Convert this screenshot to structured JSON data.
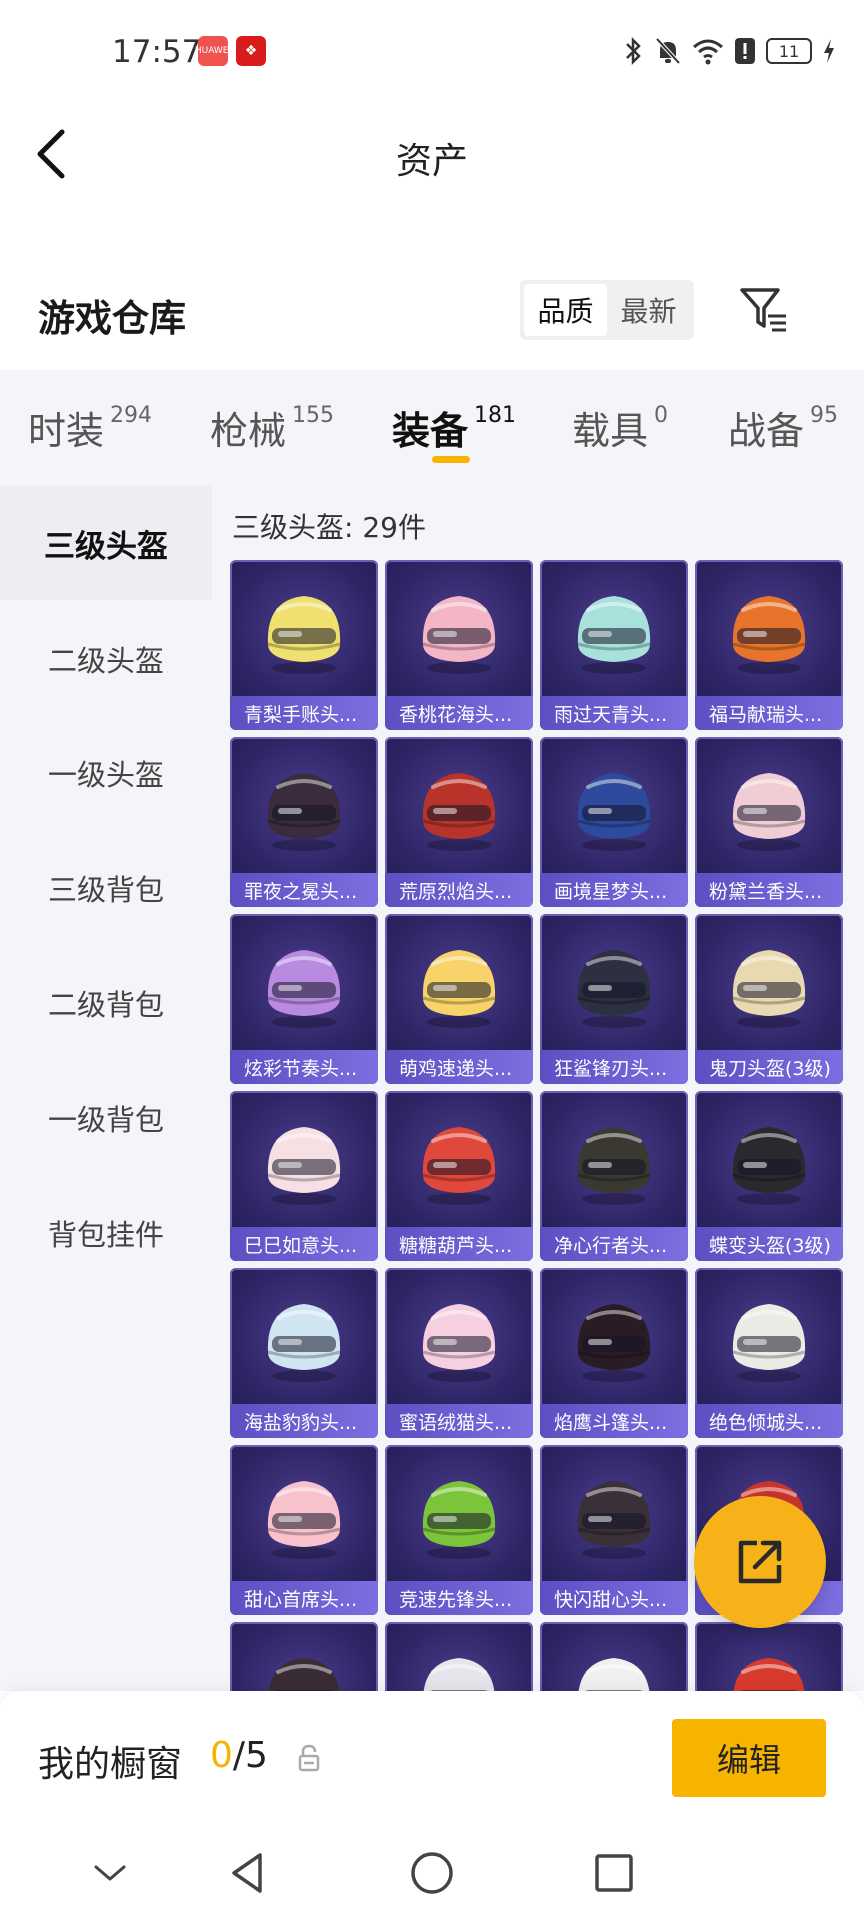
{
  "status_bar": {
    "time": "17:57",
    "battery": "11",
    "app_badges": [
      "HUAWEI",
      "❖"
    ],
    "icons": [
      "bluetooth-icon",
      "mute-bell-icon",
      "wifi-icon",
      "notification-icon",
      "battery-icon",
      "charging-icon"
    ]
  },
  "header": {
    "title": "资产",
    "back_icon": "chevron-left-icon"
  },
  "warehouse": {
    "title": "游戏仓库",
    "sort_options": [
      "品质",
      "最新"
    ],
    "active_sort": "品质",
    "filter_icon": "filter-list-icon"
  },
  "tabs": [
    {
      "label": "时装",
      "count": "294"
    },
    {
      "label": "枪械",
      "count": "155"
    },
    {
      "label": "装备",
      "count": "181"
    },
    {
      "label": "载具",
      "count": "0"
    },
    {
      "label": "战备",
      "count": "95"
    }
  ],
  "active_tab": "装备",
  "sidebar": {
    "items": [
      {
        "label": "三级头盔"
      },
      {
        "label": "二级头盔"
      },
      {
        "label": "一级头盔"
      },
      {
        "label": "三级背包"
      },
      {
        "label": "二级背包"
      },
      {
        "label": "一级背包"
      },
      {
        "label": "背包挂件"
      }
    ],
    "active": "三级头盔"
  },
  "content": {
    "heading": "三级头盔: 29件",
    "items": [
      {
        "name": "青梨手账头...",
        "color": "#f0e070"
      },
      {
        "name": "香桃花海头...",
        "color": "#f4b6c6"
      },
      {
        "name": "雨过天青头...",
        "color": "#a8e0dc"
      },
      {
        "name": "福马献瑞头...",
        "color": "#e8742c"
      },
      {
        "name": "罪夜之冕头...",
        "color": "#3a2c3c"
      },
      {
        "name": "荒原烈焰头...",
        "color": "#b8342a"
      },
      {
        "name": "画境星梦头...",
        "color": "#2e4a9c"
      },
      {
        "name": "粉黛兰香头...",
        "color": "#f0ccd4"
      },
      {
        "name": "炫彩节奏头...",
        "color": "#b88ae0"
      },
      {
        "name": "萌鸡速递头...",
        "color": "#f7d36a"
      },
      {
        "name": "狂鲨锋刃头...",
        "color": "#2c3040"
      },
      {
        "name": "鬼刀头盔(3级)",
        "color": "#e8d9b0"
      },
      {
        "name": "巳巳如意头...",
        "color": "#f6e0e4"
      },
      {
        "name": "糖糖葫芦头...",
        "color": "#e0483c"
      },
      {
        "name": "净心行者头...",
        "color": "#3a3830"
      },
      {
        "name": "蝶变头盔(3级)",
        "color": "#2a2a2e"
      },
      {
        "name": "海盐豹豹头...",
        "color": "#cfe6f2"
      },
      {
        "name": "蜜语绒猫头...",
        "color": "#f6cfe0"
      },
      {
        "name": "焰鹰斗篷头...",
        "color": "#2a1c24"
      },
      {
        "name": "绝色倾城头...",
        "color": "#e8ece4"
      },
      {
        "name": "甜心首席头...",
        "color": "#f7c2cc"
      },
      {
        "name": "竞速先锋头...",
        "color": "#7cc43a"
      },
      {
        "name": "快闪甜心头...",
        "color": "#3a3038"
      },
      {
        "name": "",
        "color": "#c8352c"
      },
      {
        "name": "",
        "color": "#3a2c34"
      },
      {
        "name": "",
        "color": "#e8e4ec"
      },
      {
        "name": "",
        "color": "#f0f0f0"
      },
      {
        "name": "",
        "color": "#d83a2c"
      }
    ]
  },
  "fab": {
    "icon": "share-external-icon"
  },
  "showcase": {
    "label": "我的橱窗",
    "current": "0",
    "separator": "/",
    "total": "5",
    "lock_icon": "lock-icon",
    "edit_label": "编辑"
  },
  "nav_bar": {
    "icons": [
      "collapse-chevron-icon",
      "back-triangle-icon",
      "home-circle-icon",
      "recents-square-icon"
    ]
  },
  "colors": {
    "accent": "#f6b300",
    "card_label": "#6a5dd1",
    "card_bg": "#2e2566"
  }
}
